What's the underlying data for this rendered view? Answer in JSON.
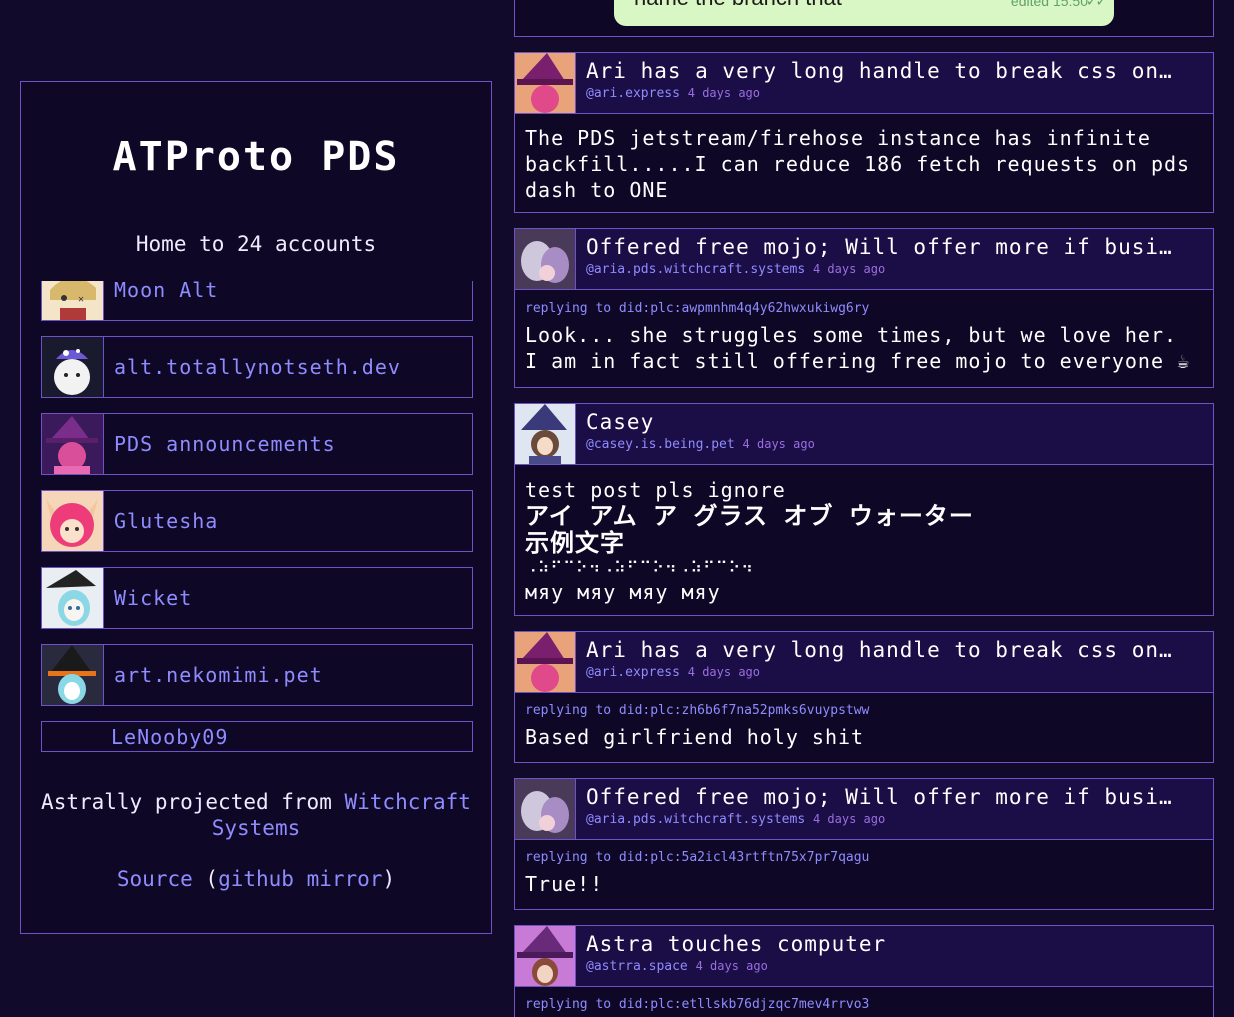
{
  "left": {
    "title": "ATProto PDS",
    "subtitle": "Home to 24 accounts",
    "accounts": [
      {
        "name": "Moon Alt"
      },
      {
        "name": "alt.totallynotseth.dev"
      },
      {
        "name": "PDS announcements"
      },
      {
        "name": "Glutesha"
      },
      {
        "name": "Wicket"
      },
      {
        "name": "art.nekomimi.pet"
      },
      {
        "name": "LeNooby09"
      }
    ],
    "footer_prefix": "Astrally projected from",
    "footer_link": "Witchcraft Systems",
    "source_link": "Source",
    "mirror_open": "(",
    "mirror_link": "github mirror",
    "mirror_close": ")"
  },
  "feed": {
    "top_bubble": {
      "text": "name the branch that",
      "meta": "edited 15:50",
      "ticks": "✓✓"
    },
    "posts": [
      {
        "title": "Ari has a very long handle to break css on…",
        "handle": "@ari.express",
        "ago": "4 days ago",
        "reply": "",
        "text": "The PDS jetstream/firehose instance has infinite backfill.....I can reduce 186 fetch requests on pds dash to ONE"
      },
      {
        "title": "Offered free mojo; Will offer more if busi…",
        "handle": "@aria.pds.witchcraft.systems",
        "ago": "4 days ago",
        "reply": "replying to did:plc:awpmnhm4q4y62hwxukiwg6ry",
        "text": "Look... she struggles some times, but we love her. I am in fact still offering free mojo to everyone ☕"
      },
      {
        "title": "Casey",
        "handle": "@casey.is.being.pet",
        "ago": "4 days ago",
        "reply": "",
        "text_line1": "test post pls ignore",
        "text_line2": "アイ アム ア グラス オブ ウォーター",
        "text_line3": "示例文字",
        "text_line4": "⠠⠵⠋⠉⠕⠲⠠⠵⠋⠉⠕⠲⠠⠵⠋⠉⠕⠲",
        "text_line5": "мяу мяу мяу мяу"
      },
      {
        "title": "Ari has a very long handle to break css on…",
        "handle": "@ari.express",
        "ago": "4 days ago",
        "reply": "replying to did:plc:zh6b6f7na52pmks6vuypstww",
        "text": "Based girlfriend holy shit"
      },
      {
        "title": "Offered free mojo; Will offer more if busi…",
        "handle": "@aria.pds.witchcraft.systems",
        "ago": "4 days ago",
        "reply": "replying to did:plc:5a2icl43rtftn75x7pr7qagu",
        "text": "True!!"
      },
      {
        "title": "Astra touches computer",
        "handle": "@astrra.space",
        "ago": "4 days ago",
        "reply": "replying to did:plc:etllskb76djzqc7mev4rrvo3",
        "text": ""
      }
    ]
  },
  "colors": {
    "background": "#120a2b",
    "panel": "#0e0726",
    "border": "#6e52c8",
    "link": "#8f8cff",
    "header": "#1b0d45"
  }
}
